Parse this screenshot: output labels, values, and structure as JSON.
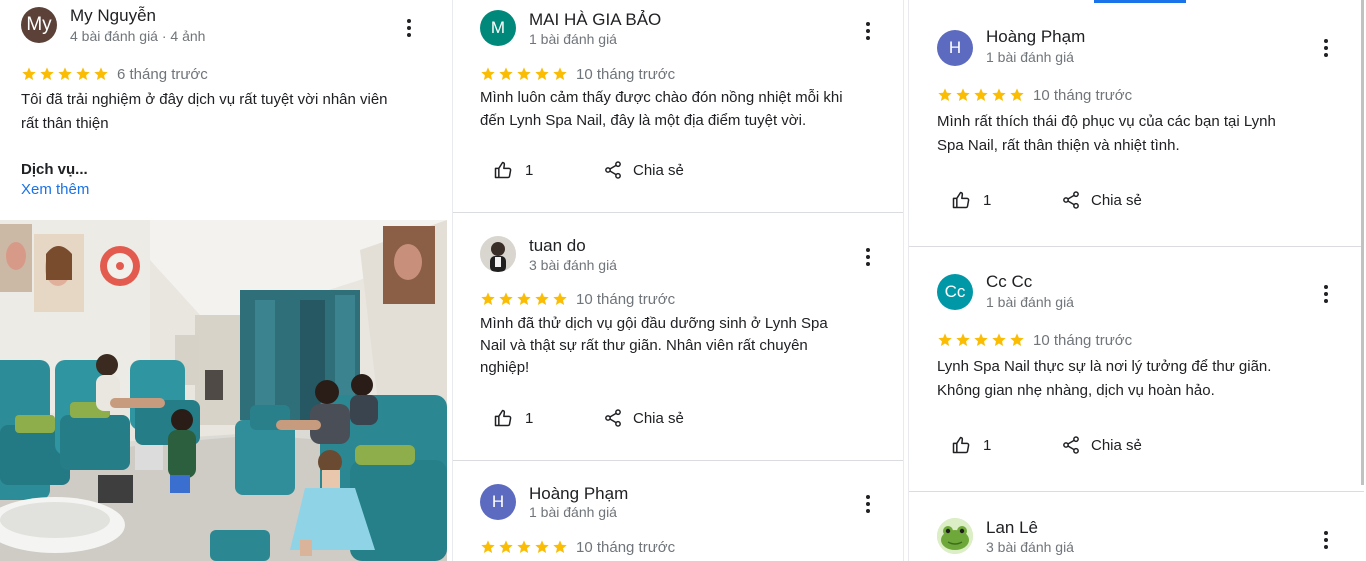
{
  "col1": {
    "review": {
      "avatar_text": "My",
      "avatar_color": "#5b4137",
      "name": "My Nguyễn",
      "meta": "4 bài đánh giá · 4 ảnh",
      "time": "6 tháng trước",
      "text_line1": "Tôi đã trải nghiệm ở đây dịch vụ rất tuyệt vời nhân viên",
      "text_line2": "rất thân thiện",
      "section_label": "Dịch vụ...",
      "more_label": "Xem thêm"
    }
  },
  "col2": {
    "r1": {
      "avatar_text": "M",
      "avatar_color": "#00897b",
      "name": "MAI HÀ GIA BẢO",
      "meta": "1 bài đánh giá",
      "time": "10 tháng trước",
      "text_line1": "Mình luôn cảm thấy được chào đón nồng nhiệt mỗi khi",
      "text_line2": "đến Lynh Spa   Nail, đây là một địa điểm tuyệt vời.",
      "likes": "1",
      "share_label": "Chia sẻ"
    },
    "r2": {
      "name": "tuan do",
      "meta": "3 bài đánh giá",
      "time": "10 tháng trước",
      "text_line1": "Mình đã thử dịch vụ gội đầu dưỡng sinh ở Lynh Spa",
      "text_line2": "Nail và thật sự rất thư giãn. Nhân viên rất chuyên",
      "text_line3": "nghiệp!",
      "likes": "1",
      "share_label": "Chia sẻ"
    },
    "r3": {
      "avatar_text": "H",
      "avatar_color": "#5c6bc0",
      "name": "Hoàng Phạm",
      "meta": "1 bài đánh giá",
      "time": "10 tháng trước"
    }
  },
  "col3": {
    "r1": {
      "avatar_text": "H",
      "avatar_color": "#5c6bc0",
      "name": "Hoàng Phạm",
      "meta": "1 bài đánh giá",
      "time": "10 tháng trước",
      "text_line1": "Mình rất thích thái độ phục vụ của các bạn tại Lynh",
      "text_line2": "Spa   Nail, rất thân thiện và nhiệt tình.",
      "likes": "1",
      "share_label": "Chia sẻ"
    },
    "r2": {
      "avatar_text": "Cc",
      "avatar_color": "#0097a7",
      "name": "Cc Cc",
      "meta": "1 bài đánh giá",
      "time": "10 tháng trước",
      "text_line1": "Lynh Spa   Nail thực sự là nơi lý tưởng để thư giãn.",
      "text_line2": "Không gian nhẹ nhàng, dịch vụ hoàn hảo.",
      "likes": "1",
      "share_label": "Chia sẻ"
    },
    "r3": {
      "name": "Lan Lê",
      "meta": "3 bài đánh giá"
    }
  },
  "colors": {
    "star": "#fbbc04",
    "link": "#1a73e8",
    "muted": "#70757a"
  },
  "rating": {
    "stars": 5
  }
}
